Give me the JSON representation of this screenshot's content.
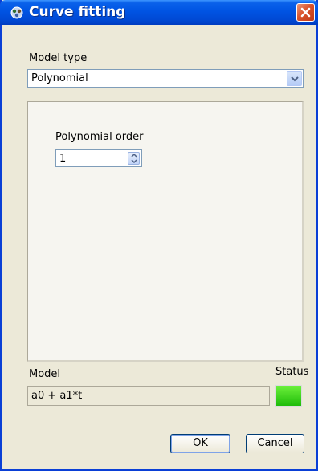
{
  "window": {
    "title": "Curve fitting"
  },
  "model_type": {
    "label": "Model type",
    "selected": "Polynomial"
  },
  "polynomial": {
    "label": "Polynomial order",
    "value": "1"
  },
  "model": {
    "label": "Model",
    "value": "a0 + a1*t"
  },
  "status": {
    "label": "Status",
    "color": "#22c40d"
  },
  "buttons": {
    "ok": "OK",
    "cancel": "Cancel"
  },
  "icons": {
    "app": "gear-cluster-icon",
    "close": "close-icon",
    "dropdown": "chevron-down-icon",
    "spin": "spin-up-down-icon"
  }
}
